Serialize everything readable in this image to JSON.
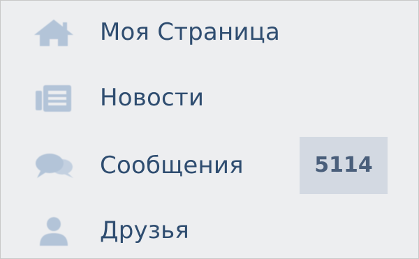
{
  "colors": {
    "background": "#edeef0",
    "label": "#2f4d70",
    "icon": "#b3c4d8",
    "badge_background": "#d3d9e2",
    "badge_text": "#4a5f7b"
  },
  "menu": {
    "items": [
      {
        "icon": "home-icon",
        "label": "Моя Страница"
      },
      {
        "icon": "news-icon",
        "label": "Новости"
      },
      {
        "icon": "messages-icon",
        "label": "Сообщения",
        "badge": "5114"
      },
      {
        "icon": "friends-icon",
        "label": "Друзья"
      }
    ]
  }
}
